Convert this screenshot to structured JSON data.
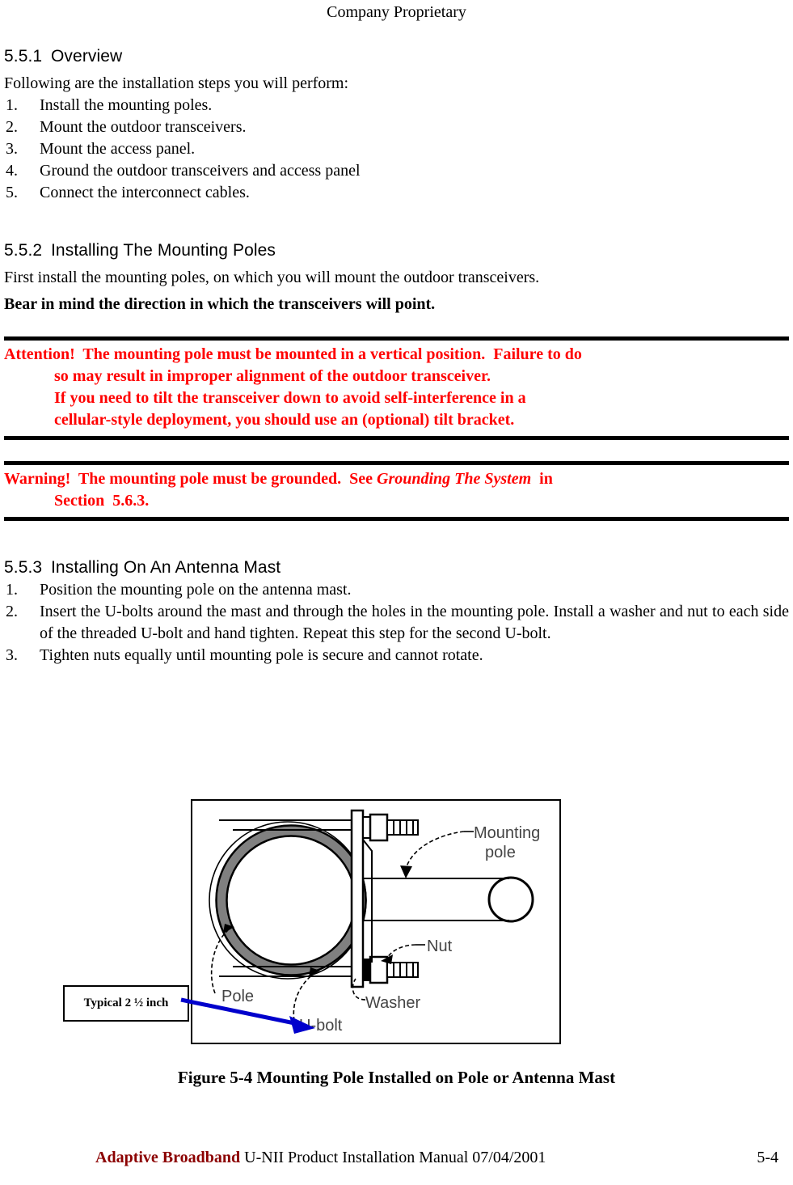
{
  "header": {
    "text": "Company Proprietary"
  },
  "sections": {
    "overview": {
      "number": "5.5.1",
      "title": "Overview",
      "intro": "Following are the installation steps you will perform:",
      "steps": [
        {
          "marker": "1.",
          "text": "Install the mounting poles."
        },
        {
          "marker": "2.",
          "text": "Mount the outdoor transceivers."
        },
        {
          "marker": "3.",
          "text": "Mount the access panel."
        },
        {
          "marker": "4.",
          "text": "Ground the outdoor transceivers and access panel"
        },
        {
          "marker": "5.",
          "text": "Connect the interconnect cables."
        }
      ]
    },
    "installing_poles": {
      "number": "5.5.2",
      "title": "Installing The Mounting Poles",
      "para1": "First install the mounting poles, on which you will mount the outdoor transceivers.",
      "para2_bold": "Bear in mind the direction in which the transceivers will point."
    },
    "antenna_mast": {
      "number": "5.5.3",
      "title": "Installing On An Antenna Mast",
      "steps": [
        {
          "marker": "1.",
          "text": "Position the mounting pole on the antenna mast."
        },
        {
          "marker": "2.",
          "text": "Insert the U-bolts around the mast and through the holes in the mounting pole.  Install a washer and nut to each side of the threaded U-bolt and hand tighten.  Repeat this step for the second U-bolt."
        },
        {
          "marker": "3.",
          "text": "Tighten nuts equally until mounting pole is secure and cannot rotate."
        }
      ]
    }
  },
  "alerts": {
    "attention": {
      "label": "Attention!",
      "lines": [
        "Attention!  The mounting pole must be mounted in a vertical position.  Failure to do",
        "so may result in improper alignment of the outdoor transceiver.",
        "If you need to tilt the transceiver down to avoid self-interference in a",
        "cellular-style deployment, you should use an (optional) tilt bracket."
      ],
      "color": "#FF0000"
    },
    "warning": {
      "label": "Warning!",
      "line1_prefix": "Warning!  The mounting pole must be grounded.  See ",
      "line1_italic": "Grounding The System",
      "line1_suffix": "  in",
      "line2": "Section  5.6.3.",
      "color": "#FF0000"
    }
  },
  "figure": {
    "caption": "Figure 5-4  Mounting Pole Installed on Pole or Antenna Mast",
    "callout": "Typical 2 ½ inch",
    "labels": {
      "mounting_pole_line1": "Mounting",
      "mounting_pole_line2": "pole",
      "nut": "Nut",
      "washer": "Washer",
      "pole": "Pole",
      "ubolt": "U-bolt"
    },
    "colors": {
      "pole_ring": "#808080",
      "outline": "#000000",
      "arrow": "#0000CC"
    }
  },
  "footer": {
    "brand": "Adaptive Broadband",
    "manual": "U-NII Product Installation Manual  07/04/2001",
    "page_number": "5-4"
  }
}
